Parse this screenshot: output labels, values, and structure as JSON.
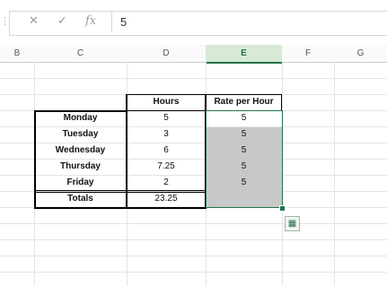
{
  "formula_bar": {
    "cancel_icon": "close-icon",
    "enter_icon": "check-icon",
    "fx_label": "fx",
    "value": "5"
  },
  "columns": [
    "B",
    "C",
    "D",
    "E",
    "F",
    "G"
  ],
  "selected_column": "E",
  "table": {
    "headers": {
      "hours": "Hours",
      "rate": "Rate per Hour"
    },
    "rows": [
      {
        "day": "Monday",
        "hours": "5",
        "rate": "5"
      },
      {
        "day": "Tuesday",
        "hours": "3",
        "rate": "5"
      },
      {
        "day": "Wednesday",
        "hours": "6",
        "rate": "5"
      },
      {
        "day": "Thursday",
        "hours": "7.25",
        "rate": "5"
      },
      {
        "day": "Friday",
        "hours": "2",
        "rate": "5"
      }
    ],
    "totals": {
      "label": "Totals",
      "hours": "23.25",
      "rate": ""
    }
  },
  "colors": {
    "selection": "#217346",
    "shade": "#c8c8c8"
  },
  "quick_analysis_icon": "quick-analysis-icon"
}
